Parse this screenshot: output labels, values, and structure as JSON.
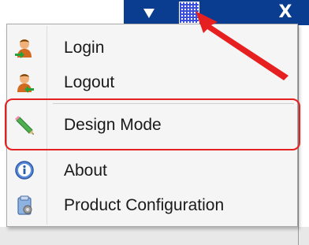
{
  "menu": {
    "items": [
      {
        "label": "Login",
        "icon": "user-login-icon"
      },
      {
        "label": "Logout",
        "icon": "user-logout-icon"
      },
      {
        "label": "Design Mode",
        "icon": "pencil-icon"
      },
      {
        "label": "About",
        "icon": "info-icon"
      },
      {
        "label": "Product Configuration",
        "icon": "configuration-icon"
      }
    ]
  },
  "titlebar": {
    "close_label": "X",
    "icons": [
      "dropdown-arrow-icon",
      "grid-icon"
    ]
  },
  "colors": {
    "titlebar_bg": "#0a3d8f",
    "highlight": "#e62020",
    "menu_bg": "#f5f5f5"
  }
}
